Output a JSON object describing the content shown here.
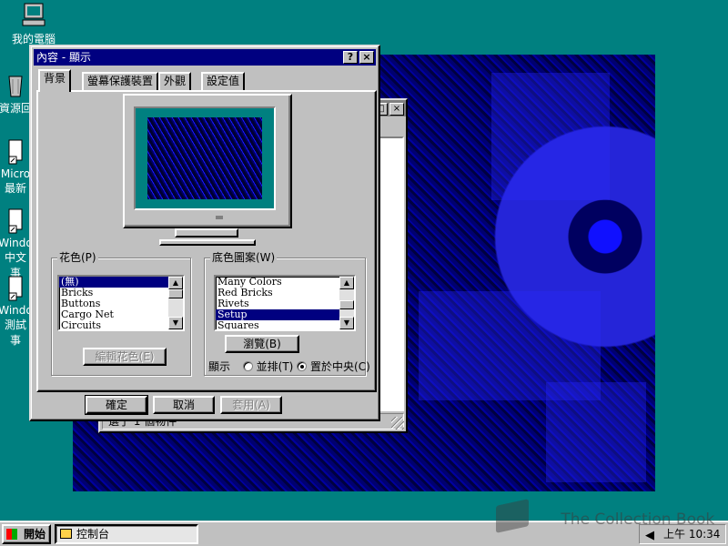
{
  "desktop": {
    "icons": [
      {
        "label": "我的電腦",
        "icon": "my-computer-icon"
      },
      {
        "label": "資源回",
        "icon": "recycle-bin-icon"
      },
      {
        "label": "Micro",
        "label2": "最新",
        "icon": "shortcut-icon"
      },
      {
        "label": "Windo",
        "label2": "中文",
        "label3": "事",
        "icon": "shortcut-icon"
      },
      {
        "label": "Windo",
        "label2": "測試",
        "label3": "事",
        "icon": "shortcut-icon"
      }
    ]
  },
  "back_window": {
    "status": "選了 1 個物件"
  },
  "dialog": {
    "title": "內容 - 顯示",
    "help_button": "?",
    "close_button": "×",
    "tabs": [
      {
        "label": "背景",
        "active": true
      },
      {
        "label": "螢幕保護裝置",
        "active": false
      },
      {
        "label": "外觀",
        "active": false
      },
      {
        "label": "設定值",
        "active": false
      }
    ],
    "pattern_group": {
      "label": "花色(P)",
      "items": [
        "(無)",
        "Bricks",
        "Buttons",
        "Cargo Net",
        "Circuits"
      ],
      "selected": "(無)",
      "edit_button": "編輯花色(E)"
    },
    "wallpaper_group": {
      "label": "底色圖案(W)",
      "items": [
        "Many Colors",
        "Red Bricks",
        "Rivets",
        "Setup",
        "Squares"
      ],
      "selected": "Setup",
      "browse_button": "瀏覽(B)",
      "display_label": "顯示",
      "option_tile": "並排(T)",
      "option_center": "置於中央(C)",
      "display_mode": "center"
    },
    "ok_button": "確定",
    "cancel_button": "取消",
    "apply_button": "套用(A)"
  },
  "taskbar": {
    "start_label": "開始",
    "task_label": "控制台",
    "clock": "上午 10:34"
  },
  "watermark": "The Collection Book",
  "colors": {
    "desktop": "#008080",
    "title_active": "#000080",
    "face": "#c0c0c0"
  }
}
